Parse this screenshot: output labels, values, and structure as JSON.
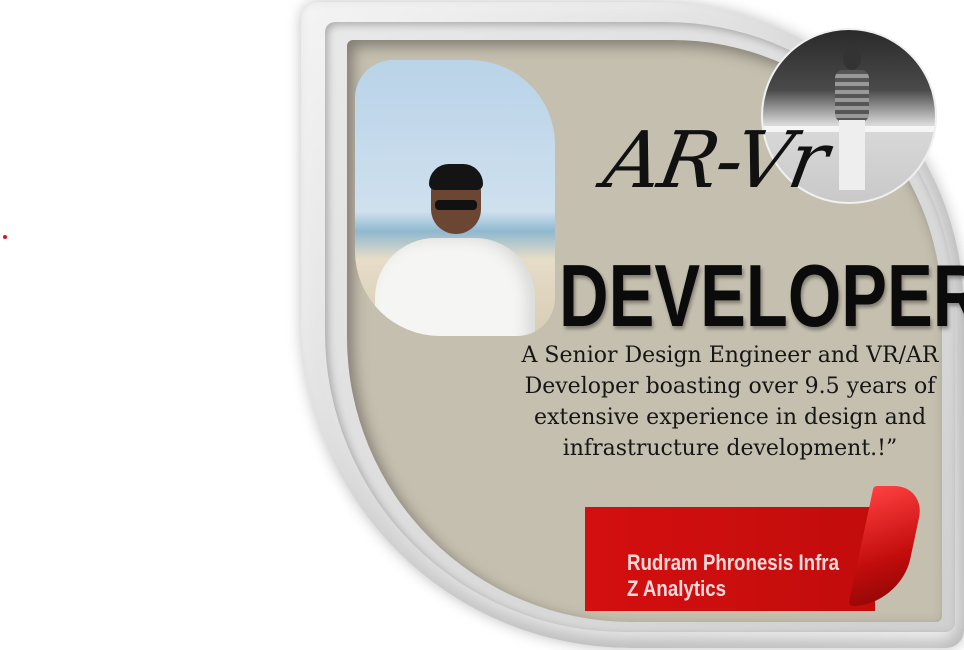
{
  "poster": {
    "script_title": "AR-Vr",
    "headline": "DEVELOPER",
    "tagline": "A Senior Design Engineer and VR/AR Developer boasting over 9.5 years of extensive experience in design and infrastructure development.!”",
    "company": "Rudram Phronesis Infra Z Analytics"
  },
  "colors": {
    "panel": "#c5bfaf",
    "ribbon": "#c20c0c",
    "accent_dot": "#e0141e"
  }
}
